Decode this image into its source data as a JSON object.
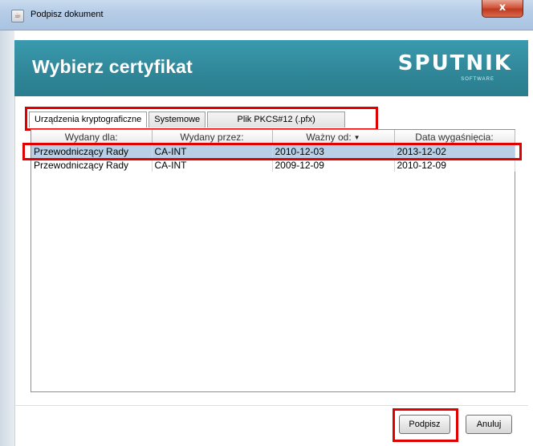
{
  "window": {
    "title": "Podpisz dokument",
    "close_label": "x"
  },
  "banner": {
    "title": "Wybierz certyfikat",
    "brand": "SPUTNIK",
    "brand_sub": "SOFTWARE"
  },
  "tabs": [
    {
      "label": "Urządzenia kryptograficzne",
      "active": true
    },
    {
      "label": "Systemowe",
      "active": false
    },
    {
      "label": "Plik PKCS#12 (.pfx)",
      "active": false
    }
  ],
  "table": {
    "columns": [
      "Wydany dla:",
      "Wydany przez:",
      "Ważny od:",
      "Data wygaśnięcia:"
    ],
    "sort_indicator": "▼",
    "rows": [
      {
        "issued_to": "Przewodniczący Rady",
        "issued_by": "CA-INT",
        "valid_from": "2010-12-03",
        "expires": "2013-12-02",
        "selected": true
      },
      {
        "issued_to": "Przewodniczący Rady",
        "issued_by": "CA-INT",
        "valid_from": "2009-12-09",
        "expires": "2010-12-09",
        "selected": false
      }
    ]
  },
  "buttons": {
    "sign": "Podpisz",
    "cancel": "Anuluj"
  },
  "colors": {
    "banner": "#2f8697",
    "selection": "#b8cfe5",
    "highlight": "#e00000"
  }
}
